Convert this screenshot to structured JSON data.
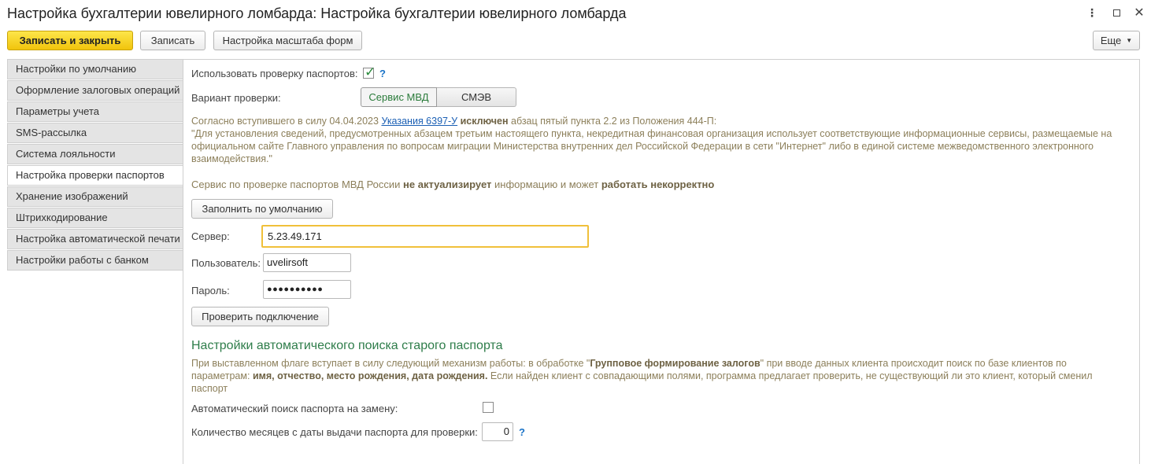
{
  "window": {
    "title": "Настройка бухгалтерии ювелирного ломбарда: Настройка бухгалтерии ювелирного ломбарда",
    "more_glyph": "⋮",
    "close_glyph": "✕"
  },
  "toolbar": {
    "save_close_label": "Записать и закрыть",
    "save_label": "Записать",
    "scale_label": "Настройка масштаба форм",
    "more_label": "Еще"
  },
  "sidebar": {
    "items": [
      {
        "label": "Настройки по умолчанию"
      },
      {
        "label": "Оформление залоговых операций"
      },
      {
        "label": "Параметры учета"
      },
      {
        "label": "SMS-рассылка"
      },
      {
        "label": "Система лояльности"
      },
      {
        "label": "Настройка проверки паспортов",
        "active": true
      },
      {
        "label": "Хранение изображений"
      },
      {
        "label": "Штрихкодирование"
      },
      {
        "label": "Настройка автоматической печати"
      },
      {
        "label": "Настройки работы с банком"
      }
    ]
  },
  "main": {
    "use_check_label": "Использовать проверку паспортов:",
    "use_check_value": true,
    "help_glyph": "?",
    "variant_label": "Вариант проверки:",
    "variant_options": [
      "Сервис МВД",
      "СМЭВ"
    ],
    "variant_selected": "Сервис МВД",
    "info": {
      "p1_a": "Согласно вступившего в силу 04.04.2023 ",
      "p1_link": "Указания 6397-У",
      "p1_bold": " исключен",
      "p1_b": " абзац пятый пункта 2.2 из Положения 444-П:",
      "p1_quote": "\"Для установления сведений, предусмотренных абзацем третьим настоящего пункта, некредитная финансовая организация использует соответствующие информационные сервисы, размещаемые на официальном сайте Главного управления по вопросам миграции Министерства внутренних дел Российской Федерации в сети \"Интернет\" либо в единой системе межведомственного электронного взаимодействия.\"",
      "p2_a": "Сервис по проверке паспортов МВД России ",
      "p2_bold1": "не актуализирует",
      "p2_b": " информацию и может ",
      "p2_bold2": "работать некорректно"
    },
    "fill_default_label": "Заполнить по умолчанию",
    "server_label": "Сервер:",
    "server_value": "5.23.49.171",
    "user_label": "Пользователь:",
    "user_value": "uvelirsoft",
    "password_label": "Пароль:",
    "password_value": "●●●●●●●●●●",
    "check_connection_label": "Проверить подключение",
    "auto_section": {
      "title": "Настройки автоматического поиска старого паспорта",
      "desc_a": "При выставленном флаге вступает в силу следующий механизм работы: в обработке \"",
      "desc_bold1": "Групповое формирование залогов",
      "desc_b": "\" при вводе данных клиента происходит поиск по базе клиентов по параметрам: ",
      "desc_bold2": "имя, отчество, место рождения, дата рождения.",
      "desc_c": " Если найден клиент с совпадающими полями, программа предлагает проверить, не существующий ли это клиент, который сменил паспорт",
      "auto_search_label": "Автоматический поиск паспорта на замену:",
      "auto_search_value": false,
      "months_label": "Количество месяцев с даты выдачи паспорта для проверки:",
      "months_value": "0"
    }
  }
}
